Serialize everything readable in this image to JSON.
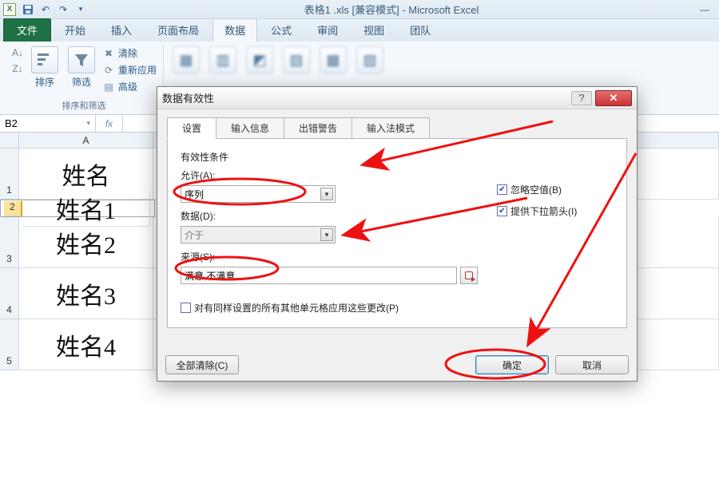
{
  "window": {
    "doc_title": "表格1 .xls  [兼容模式] - Microsoft Excel"
  },
  "ribbon": {
    "file": "文件",
    "tabs": [
      "开始",
      "插入",
      "页面布局",
      "数据",
      "公式",
      "审阅",
      "视图",
      "团队"
    ],
    "active_tab_index": 3,
    "group1_label": "排序和筛选",
    "sort_big": "排序",
    "filter_big": "筛选",
    "clear": "清除",
    "reapply": "重新应用",
    "advanced": "高级"
  },
  "namebox": "B2",
  "grid": {
    "col_a": "A",
    "rows": [
      {
        "n": "1",
        "a": "姓名"
      },
      {
        "n": "2",
        "a": "姓名1"
      },
      {
        "n": "3",
        "a": "姓名2"
      },
      {
        "n": "4",
        "a": "姓名3"
      },
      {
        "n": "5",
        "a": "姓名4"
      }
    ]
  },
  "dialog": {
    "title": "数据有效性",
    "tabs": [
      "设置",
      "输入信息",
      "出错警告",
      "输入法模式"
    ],
    "active_tab_index": 0,
    "cond_heading": "有效性条件",
    "allow_label": "允许(A):",
    "allow_value": "序列",
    "ignore_blank": "忽略空值(B)",
    "dropdown": "提供下拉箭头(I)",
    "data_label": "数据(D):",
    "data_value": "介于",
    "source_label": "来源(S):",
    "source_value": "满意,不满意",
    "apply_same": "对有同样设置的所有其他单元格应用这些更改(P)",
    "clear_all": "全部清除(C)",
    "ok": "确定",
    "cancel": "取消"
  }
}
